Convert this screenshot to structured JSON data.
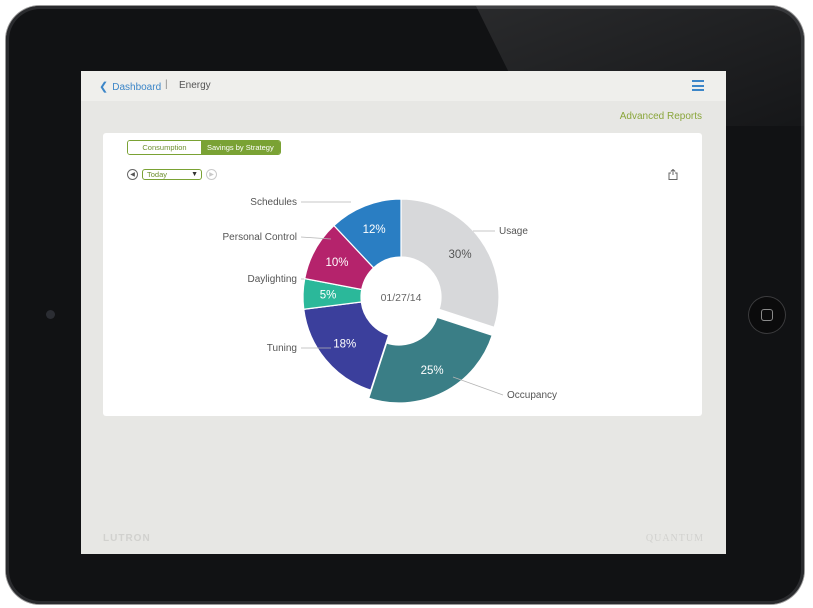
{
  "header": {
    "back_label": "Dashboard",
    "separator": "|",
    "current": "Energy"
  },
  "advanced_reports": "Advanced Reports",
  "tabs": [
    {
      "label": "Consumption",
      "active": false
    },
    {
      "label": "Savings by Strategy",
      "active": true
    }
  ],
  "period_select": {
    "value": "Today"
  },
  "chart_data": {
    "type": "pie",
    "center_label": "01/27/14",
    "slices": [
      {
        "label": "Usage",
        "value": 30,
        "display": "30%",
        "color": "#d7d8da"
      },
      {
        "label": "Occupancy",
        "value": 25,
        "display": "25%",
        "color": "#3a7e86"
      },
      {
        "label": "Tuning",
        "value": 18,
        "display": "18%",
        "color": "#3b3f9c"
      },
      {
        "label": "Daylighting",
        "value": 5,
        "display": "5%",
        "color": "#2bb89a"
      },
      {
        "label": "Personal Control",
        "value": 10,
        "display": "10%",
        "color": "#b5236c"
      },
      {
        "label": "Schedules",
        "value": 12,
        "display": "12%",
        "color": "#2a7ec3"
      }
    ]
  },
  "footer": {
    "left_brand": "LUTRON",
    "right_brand": "QUANTUM"
  },
  "colors": {
    "accent_blue": "#3c86c8",
    "accent_green": "#7aa234"
  }
}
